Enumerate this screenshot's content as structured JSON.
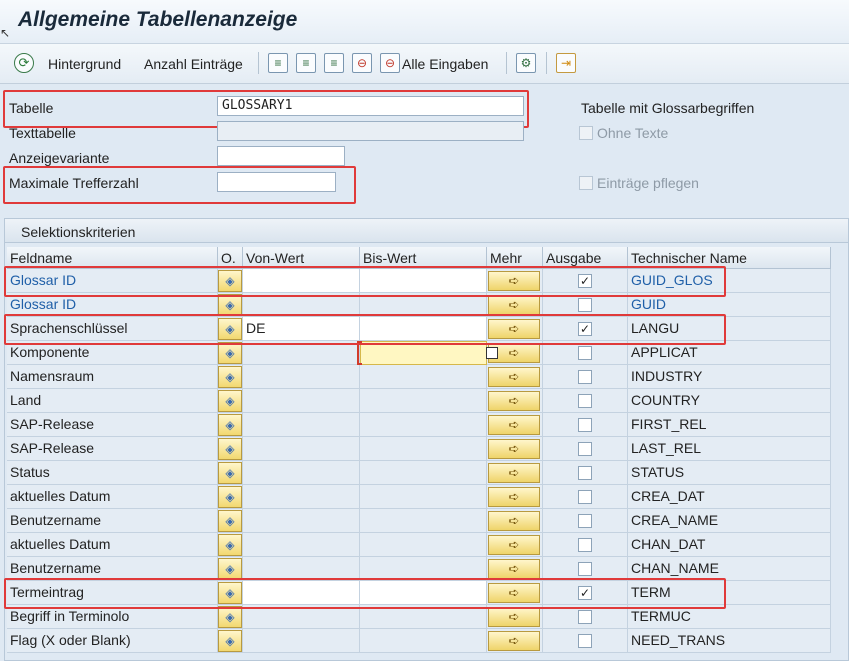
{
  "window": {
    "title": "Allgemeine Tabellenanzeige"
  },
  "toolbar": {
    "execute_icon": "execute-clock-icon",
    "hintergrund": "Hintergrund",
    "anzahl": "Anzahl Einträge",
    "alle_eingaben": "Alle Eingaben"
  },
  "params": {
    "tabelle_label": "Tabelle",
    "tabelle_value": "GLOSSARY1",
    "texttabelle_label": "Texttabelle",
    "texttabelle_value": "",
    "anzeigevariante_label": "Anzeigevariante",
    "anzeigevariante_value": "",
    "max_label": "Maximale Trefferzahl",
    "max_value": "",
    "table_desc": "Tabelle mit Glossarbegriffen",
    "ohne_texte": "Ohne Texte",
    "eintraege_pflegen": "Einträge pflegen"
  },
  "selection": {
    "header": "Selektionskriterien",
    "columns": [
      "Feldname",
      "O.",
      "Von-Wert",
      "Bis-Wert",
      "Mehr",
      "Ausgabe",
      "Technischer Name"
    ],
    "rows": [
      {
        "field": "Glossar ID",
        "von": "",
        "ausgabe": "✓",
        "tech": "GUID_GLOS",
        "link": true
      },
      {
        "field": "Glossar ID",
        "von": "",
        "ausgabe": "",
        "tech": "GUID",
        "link": true
      },
      {
        "field": "Sprachenschlüssel",
        "von": "DE",
        "ausgabe": "✓",
        "tech": "LANGU",
        "link": false
      },
      {
        "field": "Komponente",
        "von": "",
        "ausgabe": "",
        "tech": "APPLICAT",
        "link": false
      },
      {
        "field": "Namensraum",
        "von": "",
        "ausgabe": "",
        "tech": "INDUSTRY",
        "link": false
      },
      {
        "field": "Land",
        "von": "",
        "ausgabe": "",
        "tech": "COUNTRY",
        "link": false
      },
      {
        "field": "SAP-Release",
        "von": "",
        "ausgabe": "",
        "tech": "FIRST_REL",
        "link": false
      },
      {
        "field": "SAP-Release",
        "von": "",
        "ausgabe": "",
        "tech": "LAST_REL",
        "link": false
      },
      {
        "field": "Status",
        "von": "",
        "ausgabe": "",
        "tech": "STATUS",
        "link": false
      },
      {
        "field": "aktuelles Datum",
        "von": "",
        "ausgabe": "",
        "tech": "CREA_DAT",
        "link": false
      },
      {
        "field": "Benutzername",
        "von": "",
        "ausgabe": "",
        "tech": "CREA_NAME",
        "link": false
      },
      {
        "field": "aktuelles Datum",
        "von": "",
        "ausgabe": "",
        "tech": "CHAN_DAT",
        "link": false
      },
      {
        "field": "Benutzername",
        "von": "",
        "ausgabe": "",
        "tech": "CHAN_NAME",
        "link": false
      },
      {
        "field": "Termeintrag",
        "von": "",
        "ausgabe": "✓",
        "tech": "TERM",
        "link": false
      },
      {
        "field": "Begriff in Terminolo",
        "von": "",
        "ausgabe": "",
        "tech": "TERMUC",
        "link": false
      },
      {
        "field": "Flag (X oder Blank)",
        "von": "",
        "ausgabe": "",
        "tech": "NEED_TRANS",
        "link": false
      }
    ]
  }
}
